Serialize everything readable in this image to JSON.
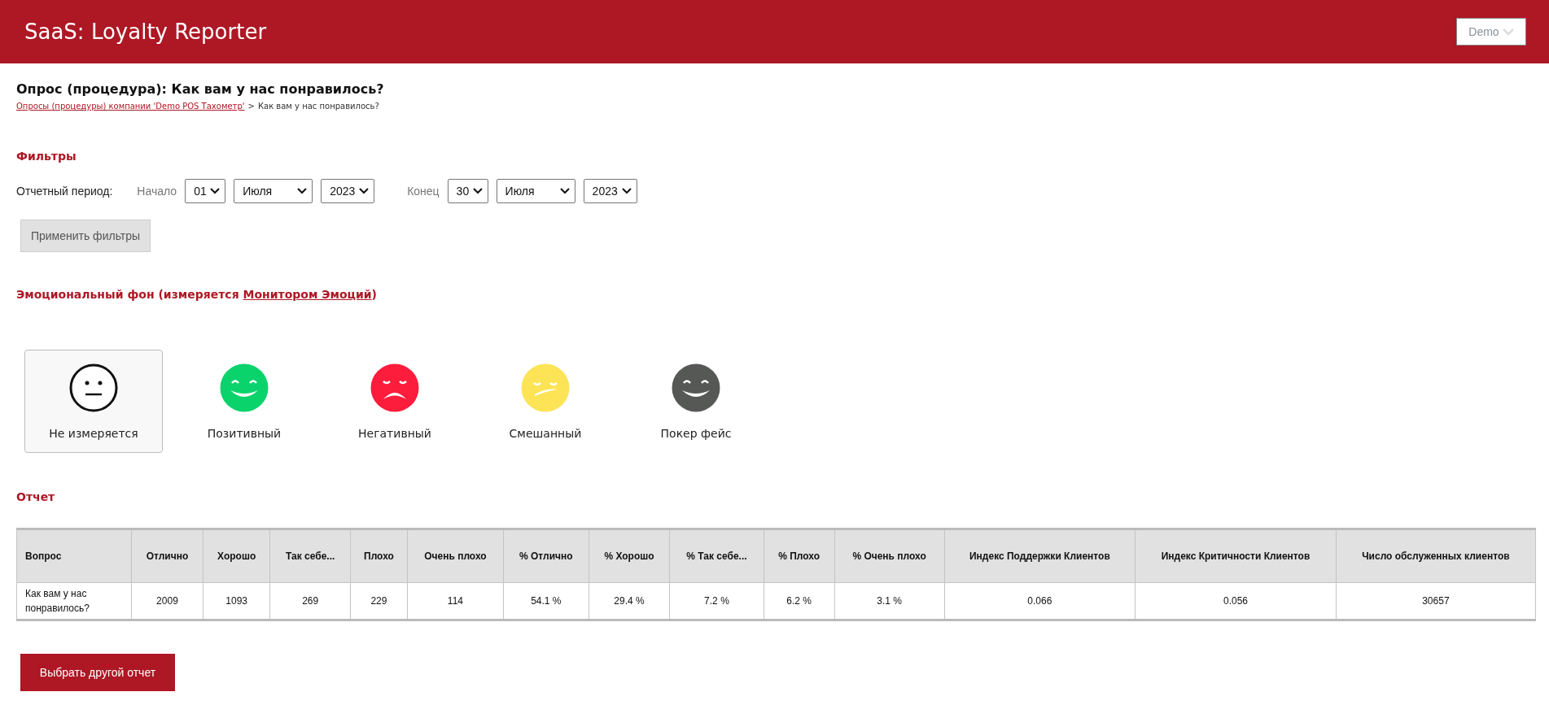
{
  "header": {
    "title": "SaaS: Loyalty Reporter",
    "account_menu": {
      "label": "Demo"
    }
  },
  "page_title": "Опрос (процедура): Как вам у нас понравилось?",
  "breadcrumb": {
    "link": "Опросы (процедуры) компании 'Demo POS Тахометр'",
    "separator": ">",
    "current": "Как вам у нас понравилось?"
  },
  "filters": {
    "heading": "Фильтры",
    "period_label": "Отчетный период:",
    "ranges": [
      {
        "label": "Начало",
        "day": "01",
        "month": "Июля",
        "year": "2023"
      },
      {
        "label": "Конец",
        "day": "30",
        "month": "Июля",
        "year": "2023"
      }
    ],
    "apply_button": "Применить фильтры"
  },
  "emotions": {
    "heading_text": "Эмоциональный фон (измеряется ",
    "heading_link": "Монитором Эмоций",
    "heading_end": ")",
    "items": [
      {
        "label": "Не измеряется",
        "kind": "neutral",
        "color": "#111111",
        "selected": true
      },
      {
        "label": "Позитивный",
        "kind": "happy",
        "color": "#0ad36b",
        "selected": false
      },
      {
        "label": "Негативный",
        "kind": "sad",
        "color": "#fc1c3c",
        "selected": false
      },
      {
        "label": "Смешанный",
        "kind": "mixed",
        "color": "#fde456",
        "selected": false
      },
      {
        "label": "Покер фейс",
        "kind": "happy",
        "color": "#565856",
        "selected": false
      }
    ]
  },
  "report": {
    "heading": "Отчет",
    "columns": [
      "Вопрос",
      "Отлично",
      "Хорошо",
      "Так себе...",
      "Плохо",
      "Очень плохо",
      "% Отлично",
      "% Хорошо",
      "% Так себе...",
      "% Плохо",
      "% Очень плохо",
      "Индекс Поддержки Клиентов",
      "Индекс Критичности Клиентов",
      "Число обслуженных клиентов"
    ],
    "rows": [
      [
        "Как вам у нас понравилось?",
        "2009",
        "1093",
        "269",
        "229",
        "114",
        "54.1 %",
        "29.4 %",
        "7.2 %",
        "6.2 %",
        "3.1 %",
        "0.066",
        "0.056",
        "30657"
      ]
    ]
  },
  "other_report_button": "Выбрать другой отчет"
}
